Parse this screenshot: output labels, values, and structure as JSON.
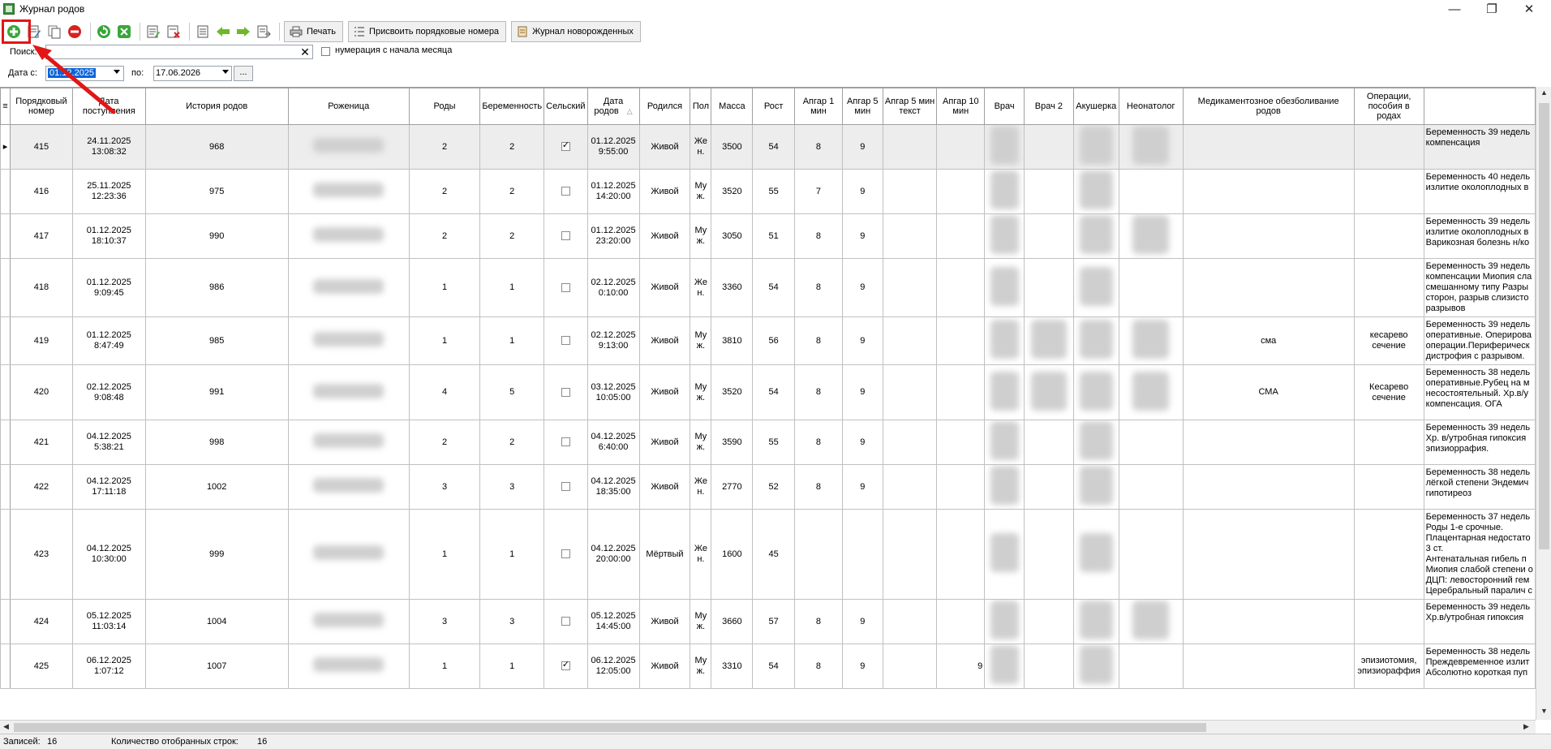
{
  "window": {
    "title": "Журнал родов",
    "minimize_glyph": "—",
    "restore_glyph": "❐",
    "close_glyph": "✕"
  },
  "toolbar": {
    "print_label": "Печать",
    "assign_numbers_label": "Присвоить порядковые номера",
    "newborn_journal_label": "Журнал новорожденных",
    "icons": [
      "add-icon",
      "edit-icon",
      "copy-icon",
      "delete-icon",
      "refresh-icon",
      "clear-filter-icon",
      "edit-doc-icon",
      "delete-doc-icon",
      "doc-icon",
      "arrow-left-icon",
      "arrow-right-icon",
      "export-icon"
    ]
  },
  "search": {
    "label": "Поиск:",
    "value": "",
    "clear_glyph": "✕"
  },
  "month_numbering": {
    "label": "нумерация с начала месяца",
    "checked": false
  },
  "dates": {
    "from_label": "Дата с:",
    "from_value": "01.12.2025",
    "to_label": "по:",
    "to_value": "17.06.2026",
    "ellipsis": "..."
  },
  "grid": {
    "columns": [
      "Порядковый номер",
      "Дата поступления",
      "История родов",
      "Роженица",
      "Роды",
      "Беременность",
      "Сельский",
      "Дата родов",
      "Родился",
      "Пол",
      "Масса",
      "Рост",
      "Апгар 1 мин",
      "Апгар 5 мин",
      "Апгар 5 мин текст",
      "Апгар 10 мин",
      "Врач",
      "Врач 2",
      "Акушерка",
      "Неонатолог",
      "Медикаментозное обезболивание родов",
      "Операции, пособия в родах",
      ""
    ],
    "sort_glyph": "△",
    "rows": [
      {
        "num": "415",
        "admit": "24.11.2025 13:08:32",
        "history": "968",
        "births": "2",
        "preg": "2",
        "rural": true,
        "bdate": "01.12.2025 9:55:00",
        "born": "Живой",
        "sex": "Же н.",
        "mass": "3500",
        "height": "54",
        "a1": "8",
        "a5": "9",
        "a10": "",
        "anest": "",
        "ops": "",
        "diag": "Беременность 39 недель\nкомпенсация"
      },
      {
        "num": "416",
        "admit": "25.11.2025 12:23:36",
        "history": "975",
        "births": "2",
        "preg": "2",
        "rural": false,
        "bdate": "01.12.2025 14:20:00",
        "born": "Живой",
        "sex": "Му ж.",
        "mass": "3520",
        "height": "55",
        "a1": "7",
        "a5": "9",
        "a10": "",
        "anest": "",
        "ops": "",
        "diag": "Беременность 40 недель\nизлитие околоплодных в"
      },
      {
        "num": "417",
        "admit": "01.12.2025 18:10:37",
        "history": "990",
        "births": "2",
        "preg": "2",
        "rural": false,
        "bdate": "01.12.2025 23:20:00",
        "born": "Живой",
        "sex": "Му ж.",
        "mass": "3050",
        "height": "51",
        "a1": "8",
        "a5": "9",
        "a10": "",
        "anest": "",
        "ops": "",
        "diag": "Беременность 39 недель\nизлитие околоплодных в\nВарикозная болезнь н/ко"
      },
      {
        "num": "418",
        "admit": "01.12.2025 9:09:45",
        "history": "986",
        "births": "1",
        "preg": "1",
        "rural": false,
        "bdate": "02.12.2025 0:10:00",
        "born": "Живой",
        "sex": "Же н.",
        "mass": "3360",
        "height": "54",
        "a1": "8",
        "a5": "9",
        "a10": "",
        "anest": "",
        "ops": "",
        "diag": "Беременность 39 недель\nкомпенсации Миопия сла\nсмешанному типу Разры\nсторон, разрыв слизисто\nразрывов"
      },
      {
        "num": "419",
        "admit": "01.12.2025 8:47:49",
        "history": "985",
        "births": "1",
        "preg": "1",
        "rural": false,
        "bdate": "02.12.2025 9:13:00",
        "born": "Живой",
        "sex": "Му ж.",
        "mass": "3810",
        "height": "56",
        "a1": "8",
        "a5": "9",
        "a10": "",
        "anest": "сма",
        "ops": "кесарево сечение",
        "diag": "Беременность 39 недель\nоперативные. Оперирова\nоперации.Периферическ\nдистрофия с разрывом."
      },
      {
        "num": "420",
        "admit": "02.12.2025 9:08:48",
        "history": "991",
        "births": "4",
        "preg": "5",
        "rural": false,
        "bdate": "03.12.2025 10:05:00",
        "born": "Живой",
        "sex": "Му ж.",
        "mass": "3520",
        "height": "54",
        "a1": "8",
        "a5": "9",
        "a10": "",
        "anest": "СМА",
        "ops": "Кесарево сечение",
        "diag": "Беременность 38 недель\nоперативные.Рубец на м\nнесостоятельный. Хр.в/у\nкомпенсация. ОГА"
      },
      {
        "num": "421",
        "admit": "04.12.2025 5:38:21",
        "history": "998",
        "births": "2",
        "preg": "2",
        "rural": false,
        "bdate": "04.12.2025 6:40:00",
        "born": "Живой",
        "sex": "Му ж.",
        "mass": "3590",
        "height": "55",
        "a1": "8",
        "a5": "9",
        "a10": "",
        "anest": "",
        "ops": "",
        "diag": "Беременность 39 недель\nХр. в/утробная гипоксия\nэпизиоррафия."
      },
      {
        "num": "422",
        "admit": "04.12.2025 17:11:18",
        "history": "1002",
        "births": "3",
        "preg": "3",
        "rural": false,
        "bdate": "04.12.2025 18:35:00",
        "born": "Живой",
        "sex": "Же н.",
        "mass": "2770",
        "height": "52",
        "a1": "8",
        "a5": "9",
        "a10": "",
        "anest": "",
        "ops": "",
        "diag": "Беременность 38 недель\nлёгкой степени Эндемич\nгипотиреоз"
      },
      {
        "num": "423",
        "admit": "04.12.2025 10:30:00",
        "history": "999",
        "births": "1",
        "preg": "1",
        "rural": false,
        "bdate": "04.12.2025 20:00:00",
        "born": "Мёртвый",
        "sex": "Же н.",
        "mass": "1600",
        "height": "45",
        "a1": "",
        "a5": "",
        "a10": "",
        "anest": "",
        "ops": "",
        "diag": "Беременность 37 недель\nРоды 1-е срочные.\nПлацентарная недостато\n3 ст.\nАнтенатальная гибель п\nМиопия слабой степени о\nДЦП: левосторонний гем\nЦеребральный паралич с"
      },
      {
        "num": "424",
        "admit": "05.12.2025 11:03:14",
        "history": "1004",
        "births": "3",
        "preg": "3",
        "rural": false,
        "bdate": "05.12.2025 14:45:00",
        "born": "Живой",
        "sex": "Му ж.",
        "mass": "3660",
        "height": "57",
        "a1": "8",
        "a5": "9",
        "a10": "",
        "anest": "",
        "ops": "",
        "diag": "Беременность 39 недель\nХр.в/утробная гипоксия"
      },
      {
        "num": "425",
        "admit": "06.12.2025 1:07:12",
        "history": "1007",
        "births": "1",
        "preg": "1",
        "rural": true,
        "bdate": "06.12.2025 12:05:00",
        "born": "Живой",
        "sex": "Му ж.",
        "mass": "3310",
        "height": "54",
        "a1": "8",
        "a5": "9",
        "a10": "9",
        "anest": "",
        "ops": "эпизиотомия, эпизиораффия",
        "diag": "Беременность 38 недель\nПреждевременное излит\nАбсолютно короткая пуп"
      }
    ]
  },
  "status": {
    "records_label": "Записей:",
    "records_value": "16",
    "filtered_label": "Количество отобранных строк:",
    "filtered_value": "16"
  },
  "colors": {
    "highlight_red": "#e21616",
    "selection_blue": "#0a64d8",
    "add_green": "#3aa63a"
  }
}
